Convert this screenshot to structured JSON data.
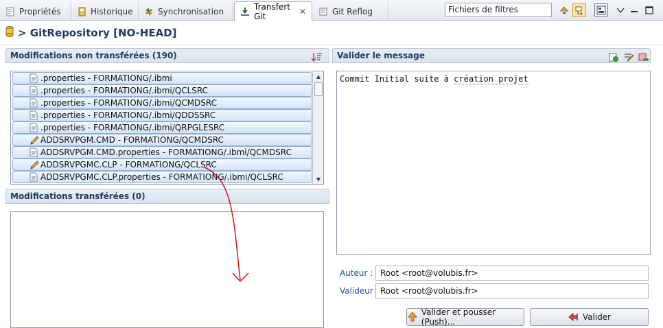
{
  "tabs": [
    {
      "label": "Propriétés",
      "icon": "properties-icon",
      "active": false
    },
    {
      "label": "Historique",
      "icon": "history-icon",
      "active": false
    },
    {
      "label": "Synchronisation",
      "icon": "synchronize-icon",
      "active": false
    },
    {
      "label": "Transfert Git",
      "icon": "git-staging-icon",
      "active": true
    },
    {
      "label": "Git Reflog",
      "icon": "reflog-icon",
      "active": false
    }
  ],
  "tab_close_glyph": "✕",
  "filter": {
    "value": "Fichiers de filtres"
  },
  "title": {
    "text": "> GitRepository [NO-HEAD]"
  },
  "unstaged": {
    "header": "Modifications non transférées (190)",
    "items": [
      {
        "label": ".properties - FORMATIONG/.ibmi",
        "icon": "properties-file-icon"
      },
      {
        "label": ".properties - FORMATIONG/.ibmi/QCLSRC",
        "icon": "properties-file-icon"
      },
      {
        "label": ".properties - FORMATIONG/.ibmi/QCMDSRC",
        "icon": "properties-file-icon"
      },
      {
        "label": ".properties - FORMATIONG/.ibmi/QDDSSRC",
        "icon": "properties-file-icon"
      },
      {
        "label": ".properties - FORMATIONG/.ibmi/QRPGLESRC",
        "icon": "properties-file-icon"
      },
      {
        "label": "ADDSRVPGM.CMD - FORMATIONG/QCMDSRC",
        "icon": "source-member-icon"
      },
      {
        "label": "ADDSRVPGM.CMD.properties - FORMATIONG/.ibmi/QCMDSRC",
        "icon": "properties-file-icon"
      },
      {
        "label": "ADDSRVPGMC.CLP - FORMATIONG/QCLSRC",
        "icon": "source-member-icon"
      },
      {
        "label": "ADDSRVPGMC.CLP.properties - FORMATIONG/.ibmi/QCLSRC",
        "icon": "properties-file-icon"
      }
    ]
  },
  "staged": {
    "header": "Modifications transférées (0)"
  },
  "commit": {
    "header": "Valider le message",
    "message_plain": "Commit Initial suite à ",
    "message_flagged": "création projet"
  },
  "author": {
    "label": "Auteur :",
    "value": "Root <root@volubis.fr>"
  },
  "committer": {
    "label": "Valideur :",
    "value": "Root <root@volubis.fr>"
  },
  "buttons": {
    "commit_push": "Valider et pousser (Push)...",
    "commit": "Valider"
  },
  "colors": {
    "accent": "#1f3b63",
    "row_fill": "#d3e4f7",
    "row_border": "#8fb0d6",
    "annotation_arrow": "#e01010",
    "label_blue": "#1f4f99"
  }
}
